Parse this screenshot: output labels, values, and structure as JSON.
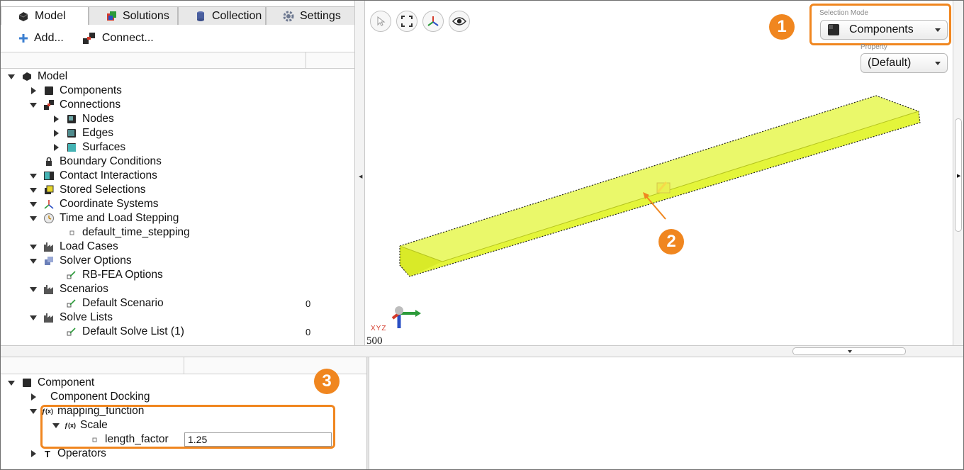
{
  "tabs": [
    {
      "label": "Model",
      "active": true,
      "icon": "model-icon"
    },
    {
      "label": "Solutions",
      "active": false,
      "icon": "solutions-icon"
    },
    {
      "label": "Collection",
      "active": false,
      "icon": "collection-icon"
    },
    {
      "label": "Settings",
      "active": false,
      "icon": "gear-icon"
    }
  ],
  "toolbar": {
    "add_label": "Add...",
    "connect_label": "Connect..."
  },
  "tree": {
    "model": "Model",
    "components": "Components",
    "connections": "Connections",
    "nodes": "Nodes",
    "edges": "Edges",
    "surfaces": "Surfaces",
    "boundary_conditions": "Boundary Conditions",
    "contact_interactions": "Contact Interactions",
    "stored_selections": "Stored Selections",
    "coordinate_systems": "Coordinate Systems",
    "time_load_stepping": "Time and Load Stepping",
    "default_time_stepping": "default_time_stepping",
    "load_cases": "Load Cases",
    "solver_options": "Solver Options",
    "rb_fea_options": "RB-FEA Options",
    "scenarios": "Scenarios",
    "default_scenario": "Default Scenario",
    "default_scenario_count": "0",
    "solve_lists": "Solve Lists",
    "default_solve_list": "Default Solve List (1)",
    "default_solve_list_count": "0"
  },
  "viewport": {
    "selection_mode_label": "Selection Mode",
    "selection_mode_value": "Components",
    "property_label": "Property",
    "property_value": "(Default)",
    "axis_label": "XYZ",
    "scale_text": "500"
  },
  "callouts": {
    "one": "1",
    "two": "2",
    "three": "3"
  },
  "accent_color": "#f0861f",
  "beam_color": "#e4f53a",
  "properties": {
    "component": "Component",
    "component_docking": "Component Docking",
    "mapping_function": "mapping_function",
    "scale": "Scale",
    "length_factor_label": "length_factor",
    "length_factor_value": "1.25",
    "operators": "Operators"
  }
}
